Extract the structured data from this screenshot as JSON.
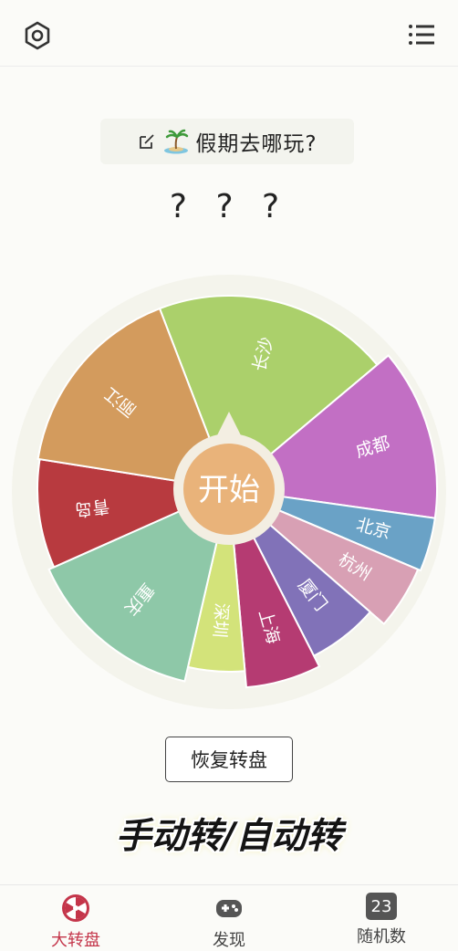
{
  "header": {
    "settings_icon": "settings-hexagon-icon",
    "menu_icon": "list-icon"
  },
  "title": {
    "edit_icon": "edit-icon",
    "emoji": "🏝️",
    "text": "假期去哪玩?"
  },
  "result_text": "? ? ?",
  "wheel": {
    "start_label": "开始",
    "segments": [
      {
        "label": "长沙",
        "color": "#abd06b"
      },
      {
        "label": "成都",
        "color": "#c26fc4"
      },
      {
        "label": "北京",
        "color": "#6aa2c6"
      },
      {
        "label": "杭州",
        "color": "#d8a0b4"
      },
      {
        "label": "厦门",
        "color": "#8172b8"
      },
      {
        "label": "上海",
        "color": "#b53b72"
      },
      {
        "label": "深圳",
        "color": "#d3e37a"
      },
      {
        "label": "重庆",
        "color": "#8ec8a8"
      },
      {
        "label": "青岛",
        "color": "#b83a3f"
      },
      {
        "label": "丽江",
        "color": "#d39b5d"
      }
    ]
  },
  "restore_button": "恢复转盘",
  "caption": "手动转/自动转",
  "nav": [
    {
      "label": "大转盘",
      "icon": "wheel-icon",
      "active": true
    },
    {
      "label": "发现",
      "icon": "gamepad-icon",
      "active": false
    },
    {
      "label": "随机数",
      "icon": "number-badge-icon",
      "badge": "23",
      "active": false
    }
  ],
  "colors": {
    "accent": "#c4354a",
    "start_button": "#e9b37a"
  }
}
